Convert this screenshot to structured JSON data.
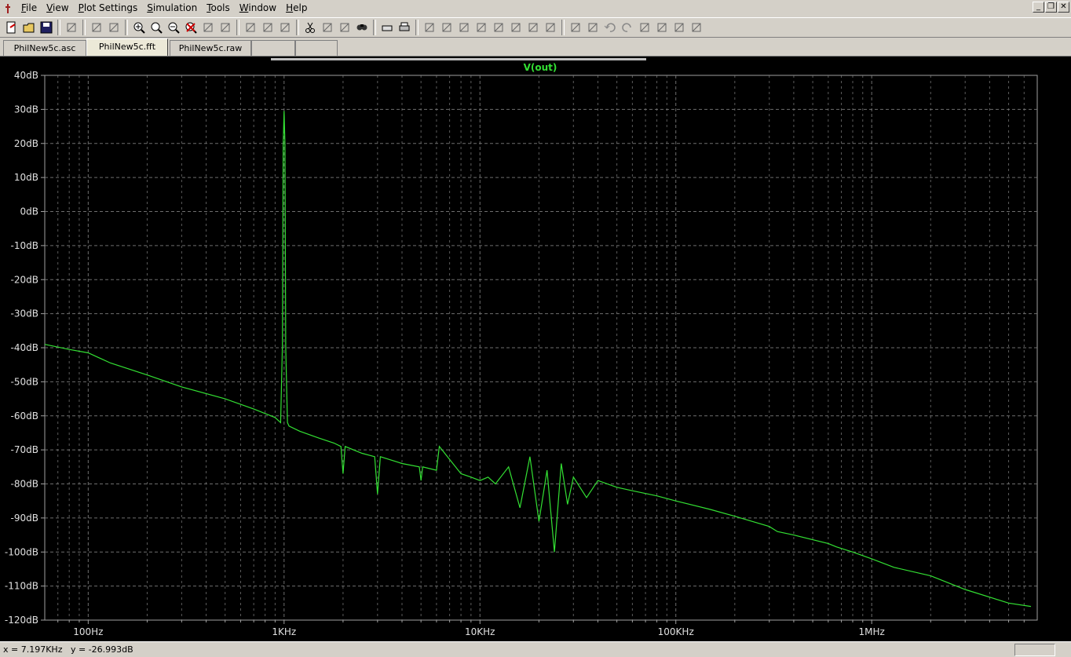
{
  "menubar": {
    "items": [
      "File",
      "View",
      "Plot Settings",
      "Simulation",
      "Tools",
      "Window",
      "Help"
    ]
  },
  "tabs": [
    {
      "label": "PhilNew5c.asc",
      "active": false
    },
    {
      "label": "PhilNew5c.fft",
      "active": true
    },
    {
      "label": "PhilNew5c.raw",
      "active": false
    },
    {
      "label": "",
      "active": false
    },
    {
      "label": "",
      "active": false
    }
  ],
  "toolbar": {
    "icons": [
      "new-schematic-icon",
      "open-icon",
      "save-icon",
      "control-panel-icon",
      "run-icon",
      "halt-icon",
      "zoom-in-icon",
      "zoom-area-icon",
      "zoom-out-icon",
      "zoom-cancel-icon",
      "autorange-icon",
      "fit-icon",
      "tile-horizontal-icon",
      "cascade-icon",
      "tile-vertical-icon",
      "cut-icon",
      "copy-icon",
      "paste-icon",
      "find-icon",
      "print-preview-icon",
      "print-icon",
      "wire-icon",
      "ground-icon",
      "label-net-icon",
      "resistor-icon",
      "capacitor-icon",
      "inductor-icon",
      "diode-icon",
      "component-icon",
      "move-icon",
      "drag-icon",
      "undo-icon",
      "redo-icon",
      "rotate-icon",
      "mirror-icon",
      "text-icon",
      "spice-directive-icon"
    ]
  },
  "status": {
    "readout": "x = 7.197KHz   y = -26.993dB"
  },
  "colors": {
    "trace": "#33e033",
    "background": "#000000",
    "grid": "#7a7a7a"
  },
  "chart_data": {
    "type": "line",
    "title": "V(out)",
    "x_scale": "log",
    "xlim": [
      60,
      7000000
    ],
    "ylim": [
      -120,
      40
    ],
    "y_unit": "dB",
    "x_ticks": [
      {
        "value": 100,
        "label": "100Hz"
      },
      {
        "value": 1000,
        "label": "1KHz"
      },
      {
        "value": 10000,
        "label": "10KHz"
      },
      {
        "value": 100000,
        "label": "100KHz"
      },
      {
        "value": 1000000,
        "label": "1MHz"
      }
    ],
    "y_ticks": [
      {
        "value": 40,
        "label": "40dB"
      },
      {
        "value": 30,
        "label": "30dB"
      },
      {
        "value": 20,
        "label": "20dB"
      },
      {
        "value": 10,
        "label": "10dB"
      },
      {
        "value": 0,
        "label": "0dB"
      },
      {
        "value": -10,
        "label": "-10dB"
      },
      {
        "value": -20,
        "label": "-20dB"
      },
      {
        "value": -30,
        "label": "-30dB"
      },
      {
        "value": -40,
        "label": "-40dB"
      },
      {
        "value": -50,
        "label": "-50dB"
      },
      {
        "value": -60,
        "label": "-60dB"
      },
      {
        "value": -70,
        "label": "-70dB"
      },
      {
        "value": -80,
        "label": "-80dB"
      },
      {
        "value": -90,
        "label": "-90dB"
      },
      {
        "value": -100,
        "label": "-100dB"
      },
      {
        "value": -110,
        "label": "-110dB"
      },
      {
        "value": -120,
        "label": "-120dB"
      }
    ],
    "grid": true,
    "series": [
      {
        "name": "V(out)",
        "x": [
          60,
          80,
          100,
          130,
          200,
          300,
          500,
          700,
          900,
          960,
          980,
          990,
          1000,
          1010,
          1020,
          1040,
          1060,
          1200,
          1500,
          1800,
          1950,
          2000,
          2050,
          2500,
          2900,
          3000,
          3100,
          4000,
          4900,
          5000,
          5100,
          6000,
          6200,
          8000,
          9000,
          10000,
          11000,
          12000,
          14000,
          16000,
          18000,
          20000,
          22000,
          24000,
          26000,
          28000,
          30000,
          35000,
          40000,
          50000,
          60000,
          80000,
          100000,
          150000,
          200000,
          300000,
          330000,
          400000,
          600000,
          660000,
          800000,
          1000000,
          1300000,
          2000000,
          3000000,
          5000000,
          6500000
        ],
        "y": [
          -39,
          -40.5,
          -41.5,
          -44.5,
          -48,
          -51.5,
          -55,
          -58,
          -60.5,
          -62,
          -40,
          20,
          29.5,
          20,
          -40,
          -62,
          -63,
          -64.5,
          -66.5,
          -68,
          -69,
          -77,
          -69,
          -71,
          -72,
          -83,
          -72,
          -74,
          -75,
          -79,
          -75,
          -76,
          -69,
          -77,
          -78,
          -79,
          -78,
          -80,
          -75,
          -87,
          -72,
          -91,
          -76,
          -100,
          -74,
          -86,
          -78,
          -84,
          -79,
          -81,
          -82,
          -83.5,
          -85,
          -87.5,
          -89.5,
          -92.5,
          -94,
          -95,
          -97.5,
          -98.5,
          -100,
          -102,
          -104.5,
          -107,
          -111,
          -115,
          -116
        ]
      }
    ]
  }
}
